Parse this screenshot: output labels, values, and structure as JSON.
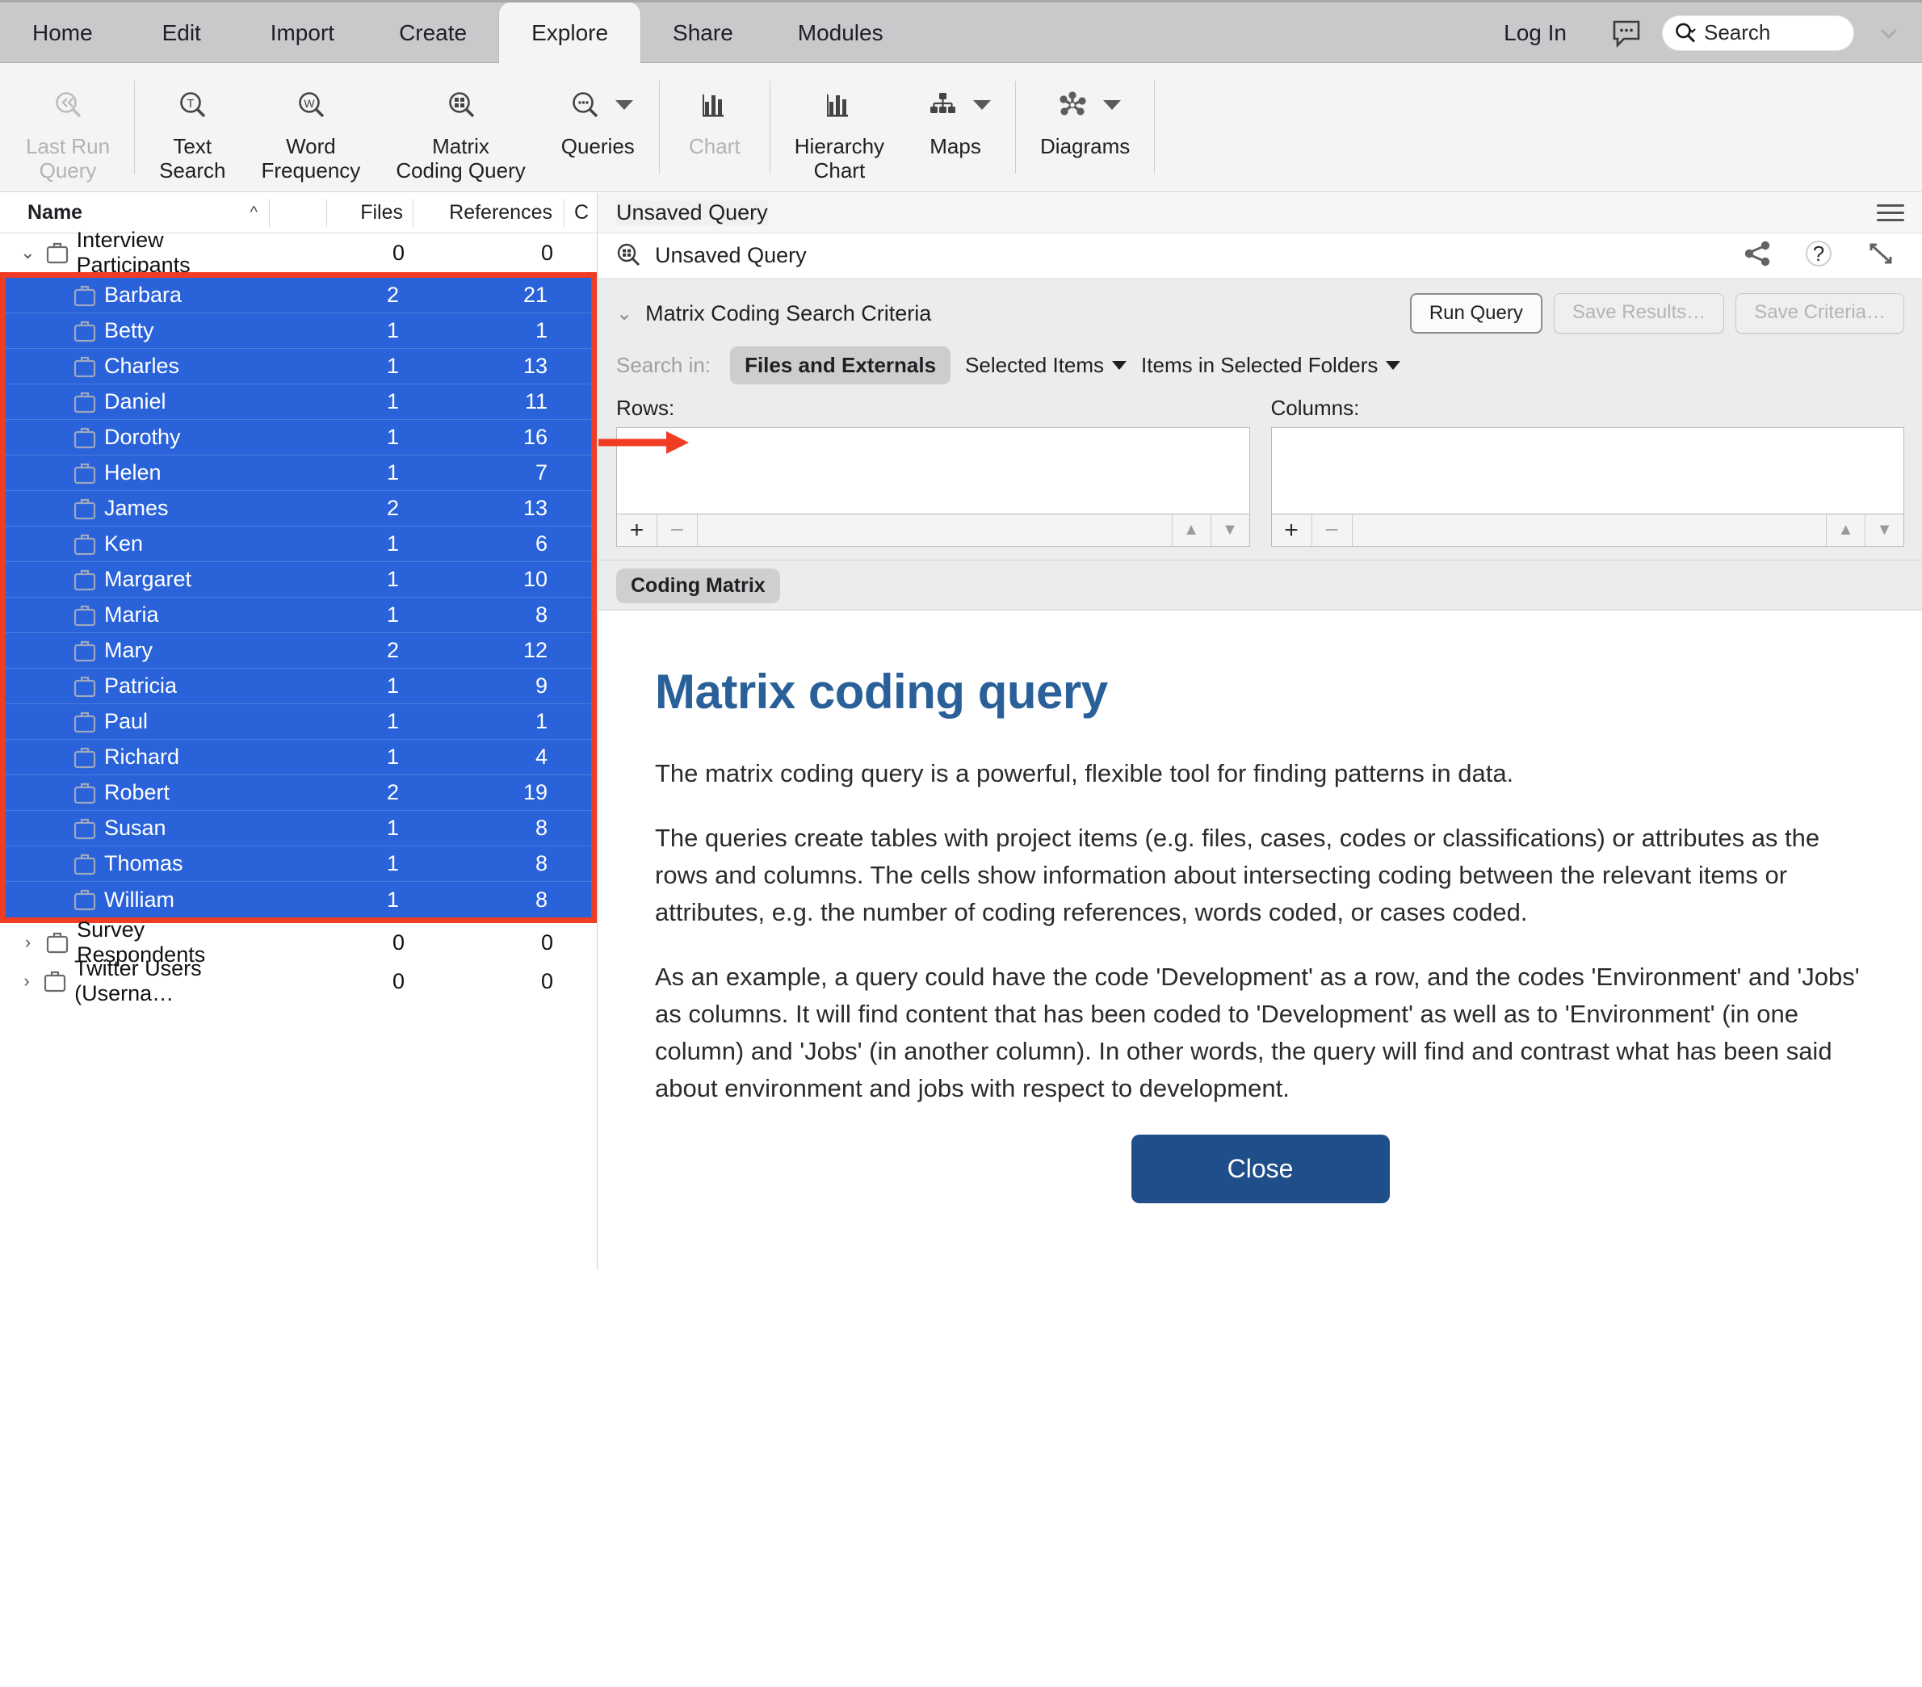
{
  "window": {
    "menu_tabs": [
      {
        "label": "Home",
        "active": false
      },
      {
        "label": "Edit",
        "active": false
      },
      {
        "label": "Import",
        "active": false
      },
      {
        "label": "Create",
        "active": false
      },
      {
        "label": "Explore",
        "active": true
      },
      {
        "label": "Share",
        "active": false
      },
      {
        "label": "Modules",
        "active": false
      }
    ],
    "login_label": "Log In",
    "chat_icon": "chat-bubble-icon",
    "search_placeholder": "Search",
    "search_icon": "search-magnifier-icon",
    "overflow_chevron": "chevron-down-icon"
  },
  "ribbon": {
    "items": [
      {
        "label": "Last Run\nQuery",
        "label_lines": [
          "Last Run",
          "Query"
        ],
        "icon": "rewind-magnifier-icon",
        "disabled": true,
        "dropdown": false
      },
      {
        "label": "Text\nSearch",
        "label_lines": [
          "Text",
          "Search"
        ],
        "icon": "text-search-magnifier-icon",
        "disabled": false,
        "dropdown": false
      },
      {
        "label": "Word\nFrequency",
        "label_lines": [
          "Word",
          "Frequency"
        ],
        "icon": "word-frequency-magnifier-icon",
        "disabled": false,
        "dropdown": false
      },
      {
        "label": "Matrix\nCoding Query",
        "label_lines": [
          "Matrix",
          "Coding Query"
        ],
        "icon": "matrix-coding-magnifier-icon",
        "disabled": false,
        "dropdown": false
      },
      {
        "label": "Queries",
        "label_lines": [
          "Queries"
        ],
        "icon": "queries-magnifier-icon",
        "disabled": false,
        "dropdown": true
      },
      {
        "label": "Chart",
        "label_lines": [
          "Chart"
        ],
        "icon": "bar-chart-icon",
        "disabled": true,
        "dropdown": false
      },
      {
        "label": "Hierarchy\nChart",
        "label_lines": [
          "Hierarchy",
          "Chart"
        ],
        "icon": "bar-chart-icon",
        "disabled": false,
        "dropdown": false
      },
      {
        "label": "Maps",
        "label_lines": [
          "Maps"
        ],
        "icon": "hierarchy-map-icon",
        "disabled": false,
        "dropdown": true
      },
      {
        "label": "Diagrams",
        "label_lines": [
          "Diagrams"
        ],
        "icon": "network-diagram-icon",
        "disabled": false,
        "dropdown": true
      }
    ]
  },
  "sidebar": {
    "columns": {
      "name": "Name",
      "files": "Files",
      "references": "References",
      "truncated": "C",
      "sort_indicator": "chevron-up-icon"
    },
    "groups": [
      {
        "name": "Interview Participants",
        "files": "0",
        "references": "0",
        "expanded": true,
        "twisty": "chevron-down-icon",
        "children": [
          {
            "name": "Barbara",
            "files": "2",
            "references": "21"
          },
          {
            "name": "Betty",
            "files": "1",
            "references": "1"
          },
          {
            "name": "Charles",
            "files": "1",
            "references": "13"
          },
          {
            "name": "Daniel",
            "files": "1",
            "references": "11"
          },
          {
            "name": "Dorothy",
            "files": "1",
            "references": "16"
          },
          {
            "name": "Helen",
            "files": "1",
            "references": "7"
          },
          {
            "name": "James",
            "files": "2",
            "references": "13"
          },
          {
            "name": "Ken",
            "files": "1",
            "references": "6"
          },
          {
            "name": "Margaret",
            "files": "1",
            "references": "10"
          },
          {
            "name": "Maria",
            "files": "1",
            "references": "8"
          },
          {
            "name": "Mary",
            "files": "2",
            "references": "12"
          },
          {
            "name": "Patricia",
            "files": "1",
            "references": "9"
          },
          {
            "name": "Paul",
            "files": "1",
            "references": "1"
          },
          {
            "name": "Richard",
            "files": "1",
            "references": "4"
          },
          {
            "name": "Robert",
            "files": "2",
            "references": "19"
          },
          {
            "name": "Susan",
            "files": "1",
            "references": "8"
          },
          {
            "name": "Thomas",
            "files": "1",
            "references": "8"
          },
          {
            "name": "William",
            "files": "1",
            "references": "8"
          }
        ]
      },
      {
        "name": "Survey Respondents",
        "files": "0",
        "references": "0",
        "expanded": false,
        "twisty": "chevron-right-icon",
        "children": []
      },
      {
        "name": "Twitter Users (Userna…",
        "files": "0",
        "references": "0",
        "expanded": false,
        "twisty": "chevron-right-icon",
        "children": []
      }
    ],
    "selection_color": "#2962d9",
    "highlight_color": "#ef3c23"
  },
  "main": {
    "doc_title": "Unsaved Query",
    "doc_subtitle": "Unsaved Query",
    "doc_subtitle_icon": "matrix-coding-magnifier-icon",
    "hamburger_icon": "menu-hamburger-icon",
    "share_icon": "share-icon",
    "help_icon": "help-question-icon",
    "expand_icon": "expand-diagonal-icon",
    "criteria": {
      "title": "Matrix Coding Search Criteria",
      "twisty": "chevron-down-icon",
      "run_query": "Run Query",
      "save_results": "Save Results…",
      "save_criteria": "Save Criteria…",
      "search_in_label": "Search in:",
      "scope_pill": "Files and Externals",
      "scope_selected_items": "Selected Items",
      "scope_items_in_folders": "Items in Selected Folders",
      "rows_label": "Rows:",
      "columns_label": "Columns:",
      "add_icon": "plus-icon",
      "remove_icon": "minus-icon",
      "move_up_icon": "triangle-up-icon",
      "move_down_icon": "triangle-down-icon"
    },
    "result_tab": "Coding Matrix",
    "overlay": {
      "heading": "Matrix coding query",
      "paragraphs": [
        "The matrix coding query is a powerful, flexible tool for finding patterns in data.",
        "The queries create tables with project items (e.g. files, cases, codes or classifications) or attributes as the rows and columns. The cells show information about intersecting coding between the relevant items or attributes, e.g. the number of coding references, words coded, or cases coded.",
        "As an example, a query could have the code 'Development' as a row, and the codes 'Environment' and 'Jobs' as columns. It will find content that has been coded to 'Development' as well as to 'Environment' (in one column) and 'Jobs' (in another column). In other words, the query will find and contrast what has been said about environment and jobs with respect to development."
      ],
      "close_label": "Close",
      "close_color": "#204e8a",
      "heading_color": "#2a6099"
    }
  }
}
